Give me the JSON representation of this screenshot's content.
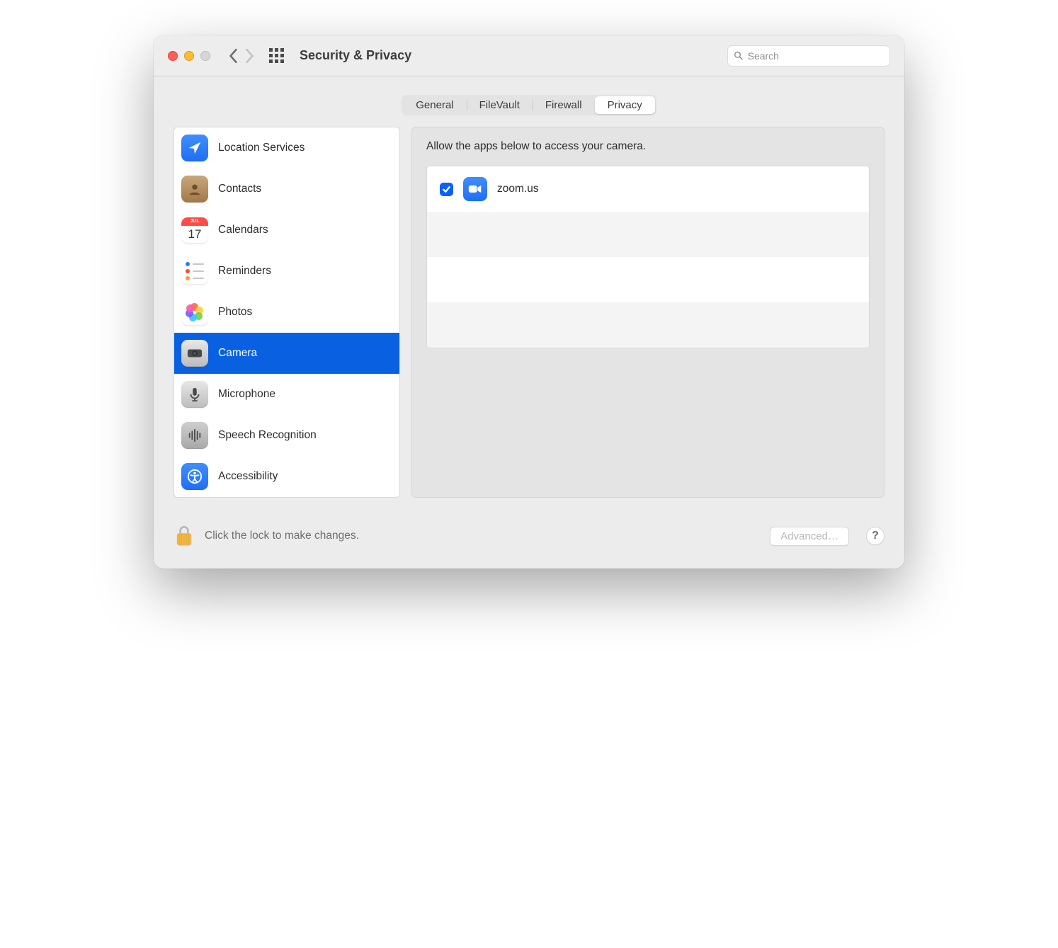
{
  "window": {
    "title": "Security & Privacy"
  },
  "search": {
    "placeholder": "Search"
  },
  "tabs": [
    {
      "id": "general",
      "label": "General",
      "active": false
    },
    {
      "id": "filevault",
      "label": "FileVault",
      "active": false
    },
    {
      "id": "firewall",
      "label": "Firewall",
      "active": false
    },
    {
      "id": "privacy",
      "label": "Privacy",
      "active": true
    }
  ],
  "sidebar": {
    "items": [
      {
        "id": "location",
        "label": "Location Services"
      },
      {
        "id": "contacts",
        "label": "Contacts"
      },
      {
        "id": "calendars",
        "label": "Calendars",
        "cal_month": "JUL",
        "cal_day": "17"
      },
      {
        "id": "reminders",
        "label": "Reminders"
      },
      {
        "id": "photos",
        "label": "Photos"
      },
      {
        "id": "camera",
        "label": "Camera",
        "selected": true
      },
      {
        "id": "mic",
        "label": "Microphone"
      },
      {
        "id": "speech",
        "label": "Speech Recognition"
      },
      {
        "id": "access",
        "label": "Accessibility"
      }
    ]
  },
  "panel": {
    "description": "Allow the apps below to access your camera.",
    "apps": [
      {
        "name": "zoom.us",
        "checked": true,
        "icon": "zoom"
      }
    ]
  },
  "footer": {
    "lock_text": "Click the lock to make changes.",
    "advanced_label": "Advanced…",
    "help_label": "?"
  }
}
